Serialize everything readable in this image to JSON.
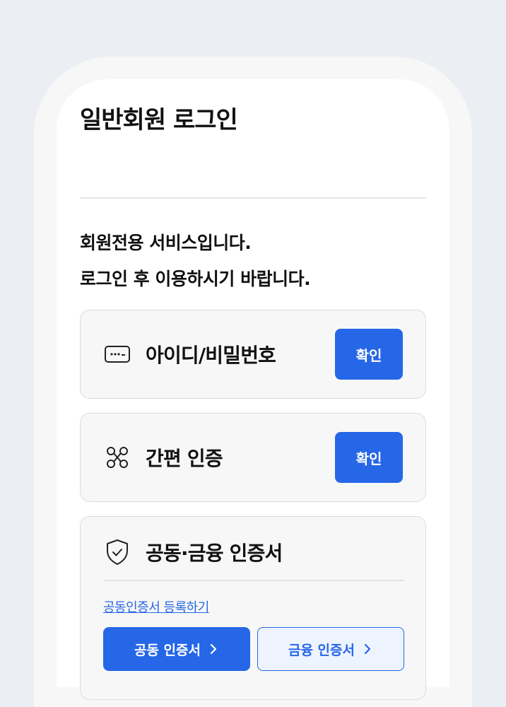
{
  "header": {
    "title": "일반회원 로그인"
  },
  "notice": {
    "line1": "회원전용 서비스입니다.",
    "line2": "로그인 후 이용하시기 바랍니다."
  },
  "login_options": {
    "id_password": {
      "label": "아이디/비밀번호",
      "button": "확인",
      "icon": "password-field-icon"
    },
    "easy_auth": {
      "label": "간편 인증",
      "button": "확인",
      "icon": "easy-auth-icon"
    },
    "certificate": {
      "label": "공동·금융 인증서",
      "icon": "shield-check-icon",
      "register_link": "공동인증서 등록하기",
      "joint_button": "공동 인증서",
      "financial_button": "금융 인증서"
    }
  },
  "colors": {
    "accent": "#2667e8",
    "card_bg": "#f7f7f7",
    "page_bg": "#ebeef3"
  }
}
